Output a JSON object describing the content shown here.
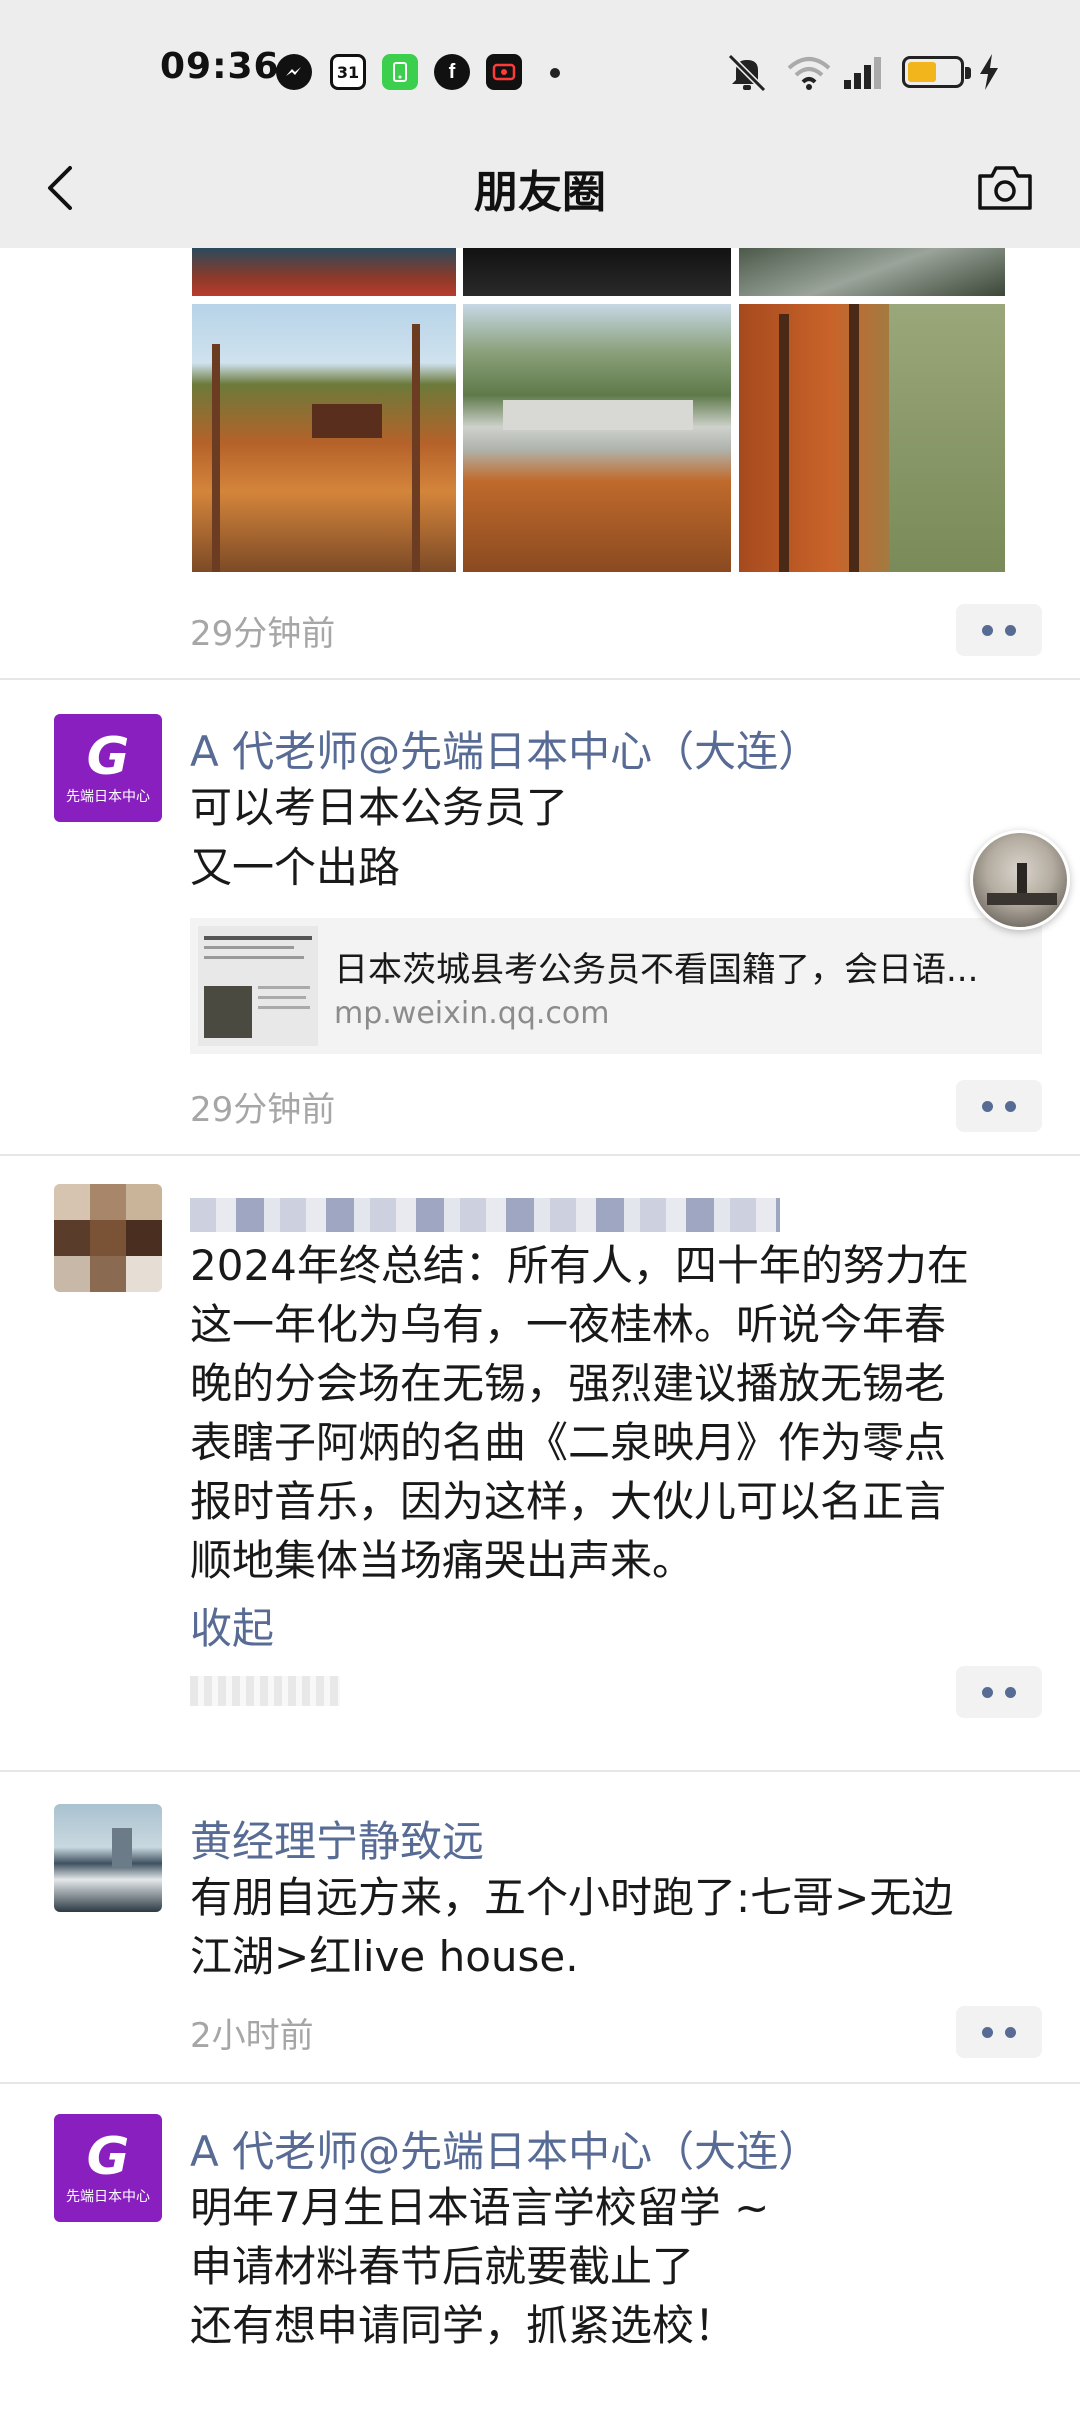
{
  "status_bar": {
    "time": "09:36",
    "battery_level": 0.55
  },
  "header": {
    "title": "朋友圈"
  },
  "posts": [
    {
      "time": "29分钟前"
    },
    {
      "author": "A 代老师@先端日本中心（大连）",
      "avatar_caption": "先端日本中心",
      "text_lines": [
        "可以考日本公务员了",
        "又一个出路"
      ],
      "share": {
        "title": "日本茨城县考公务员不看国籍了，会日语...",
        "source": "mp.weixin.qq.com"
      },
      "time": "29分钟前"
    },
    {
      "text_lines": [
        "2024年终总结：所有人，四十年的努力在",
        "这一年化为乌有，一夜桂林。听说今年春",
        "晚的分会场在无锡，强烈建议播放无锡老",
        "表瞎子阿炳的名曲《二泉映月》作为零点",
        "报时音乐，因为这样，大伙儿可以名正言",
        "顺地集体当场痛哭出声来。"
      ],
      "collapse_label": "收起"
    },
    {
      "author": "黄经理宁静致远",
      "text_lines": [
        "有朋自远方来，五个小时跑了:七哥>无边",
        "江湖>红live house."
      ],
      "time": "2小时前"
    },
    {
      "author": "A 代老师@先端日本中心（大连）",
      "avatar_caption": "先端日本中心",
      "text_lines": [
        "明年7月生日本语言学校留学 ~",
        "申请材料春节后就要截止了",
        "还有想申请同学，抓紧选校！"
      ]
    }
  ]
}
